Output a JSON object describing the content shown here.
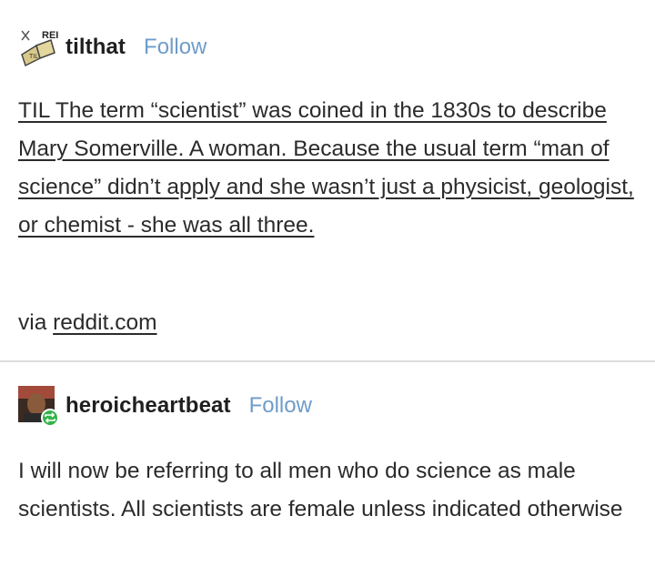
{
  "posts": [
    {
      "username": "tilthat",
      "follow_label": "Follow",
      "avatar_icon": "til-book-logo-icon",
      "avatar_text": "REI",
      "body_text": "TIL The term “scientist” was coined in the 1830s to describe Mary Somerville. A woman. Because the usual term “man of science” didn’t apply and she wasn’t just a physicist, geologist, or chemist - she was all three.",
      "via_prefix": "via",
      "via_link": "reddit.com"
    },
    {
      "username": "heroicheartbeat",
      "follow_label": "Follow",
      "avatar_icon": "user-avatar-icon",
      "reblog_badge_icon": "reblog-icon",
      "body_text": "I will now be referring to all men who do science as male scientists. All scientists are female unless indicated otherwise"
    }
  ],
  "colors": {
    "follow": "#6f9cc9",
    "text": "#2b2b2b",
    "divider": "#dcdcdc",
    "reblog_badge": "#34b34a"
  }
}
